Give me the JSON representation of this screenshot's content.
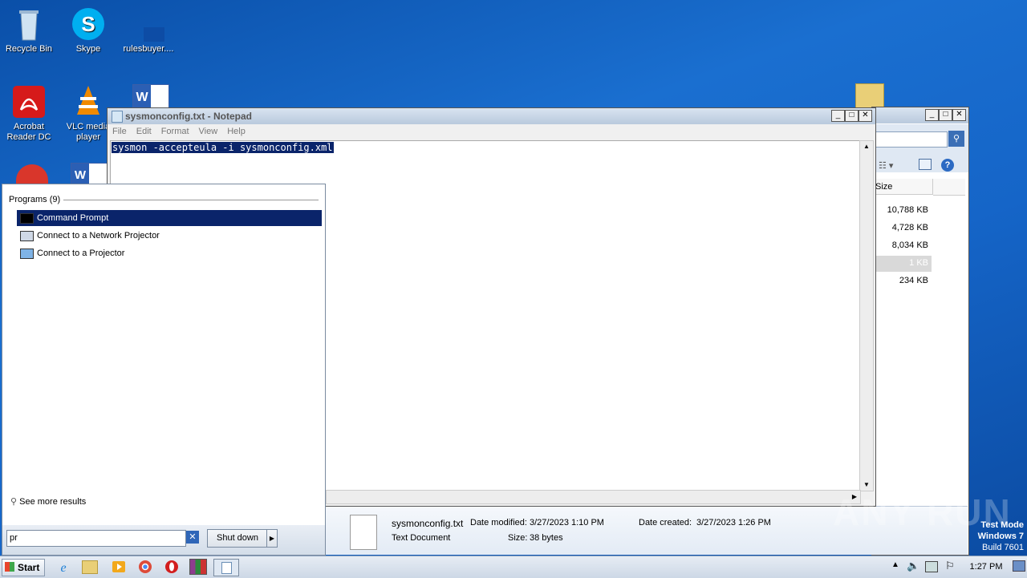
{
  "desktop": {
    "icons": [
      {
        "label": "Recycle Bin"
      },
      {
        "label": "Skype"
      },
      {
        "label": "rulesbuyer...."
      },
      {
        "label": "Acrobat Reader DC"
      },
      {
        "label": "VLC media player"
      }
    ]
  },
  "notepad": {
    "title": "sysmonconfig.txt - Notepad",
    "menu": [
      "File",
      "Edit",
      "Format",
      "View",
      "Help"
    ],
    "content": "sysmon -accepteula -i sysmonconfig.xml"
  },
  "explorer": {
    "column_size": "Size",
    "sizes": [
      "10,788 KB",
      "4,728 KB",
      "8,034 KB",
      "1 KB",
      "234 KB"
    ],
    "details": {
      "filename": "sysmonconfig.txt",
      "type": "Text Document",
      "modified_label": "Date modified:",
      "modified_value": "3/27/2023 1:10 PM",
      "created_label": "Date created:",
      "created_value": "3/27/2023 1:26 PM",
      "size_label": "Size:",
      "size_value": "38 bytes"
    }
  },
  "startmenu": {
    "group_label": "Programs (9)",
    "programs": [
      "Command Prompt",
      "Connect to a Network Projector",
      "Connect to a Projector"
    ],
    "see_more": "See more results",
    "search_value": "pr",
    "shutdown_label": "Shut down"
  },
  "taskbar": {
    "start_label": "Start",
    "clock": "1:27 PM"
  },
  "watermark": {
    "line1": "Test Mode",
    "line2": "Windows 7",
    "line3": "Build 7601",
    "brand": "ANY RUN"
  }
}
